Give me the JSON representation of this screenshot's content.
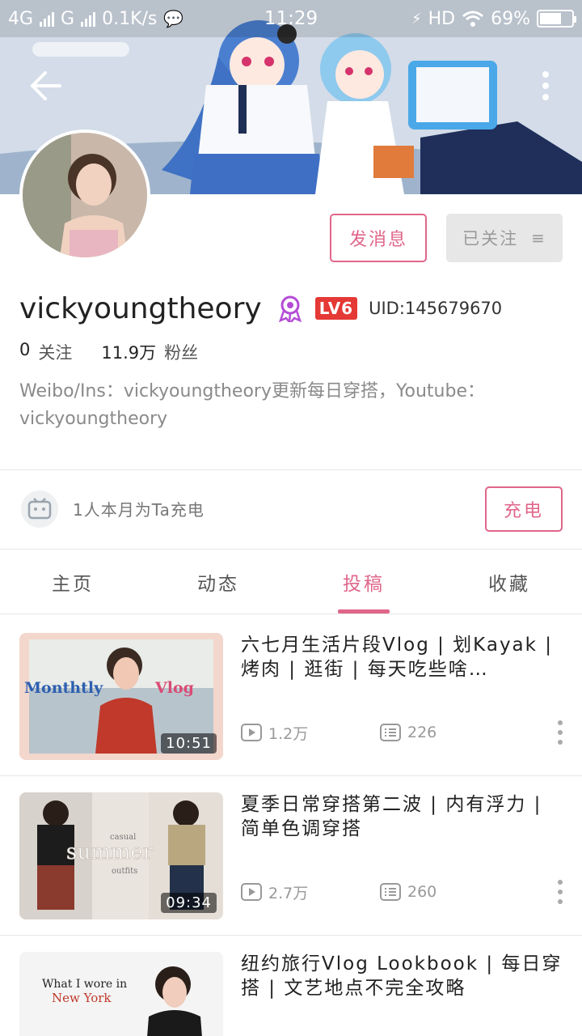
{
  "status_bar": {
    "network_1": "4G",
    "network_2": "G",
    "speed": "0.1K/s",
    "time": "11:29",
    "hd": "HD",
    "battery": "69%",
    "battery_level": 0.69
  },
  "header": {
    "back_icon": "arrow-left-icon",
    "more_icon": "more-vertical-icon"
  },
  "profile": {
    "message_button": "发消息",
    "follow_button": "已关注",
    "username": "vickyoungtheory",
    "level": "LV6",
    "uid": "UID:145679670",
    "following_count": "0",
    "following_label": "关注",
    "fans_count": "11.9万",
    "fans_label": "粉丝",
    "bio": "Weibo/Ins：vickyoungtheory更新每日穿搭，Youtube：vickyoungtheory"
  },
  "charge": {
    "text": "1人本月为Ta充电",
    "button": "充电"
  },
  "tabs": [
    {
      "label": "主页",
      "active": false
    },
    {
      "label": "动态",
      "active": false
    },
    {
      "label": "投稿",
      "active": true
    },
    {
      "label": "收藏",
      "active": false
    }
  ],
  "videos": [
    {
      "title": "六七月生活片段Vlog | 划Kayak | 烤肉 | 逛街 | 每天吃些啥…",
      "duration": "10:51",
      "plays": "1.2万",
      "comments": "226",
      "thumb_text_1": "Monthtly",
      "thumb_text_2": "Vlog"
    },
    {
      "title": "夏季日常穿搭第二波 | 内有浮力 | 简单色调穿搭",
      "duration": "09:34",
      "plays": "2.7万",
      "comments": "260",
      "thumb_text_1": "casual",
      "thumb_text_2": "summer",
      "thumb_text_3": "outfits"
    },
    {
      "title": "纽约旅行Vlog Lookbook | 每日穿搭 | 文艺地点不完全攻略",
      "duration": "",
      "thumb_text_1": "What I wore in",
      "thumb_text_2": "New York"
    }
  ],
  "colors": {
    "accent": "#e0668a",
    "lv_badge": "#e53935"
  }
}
